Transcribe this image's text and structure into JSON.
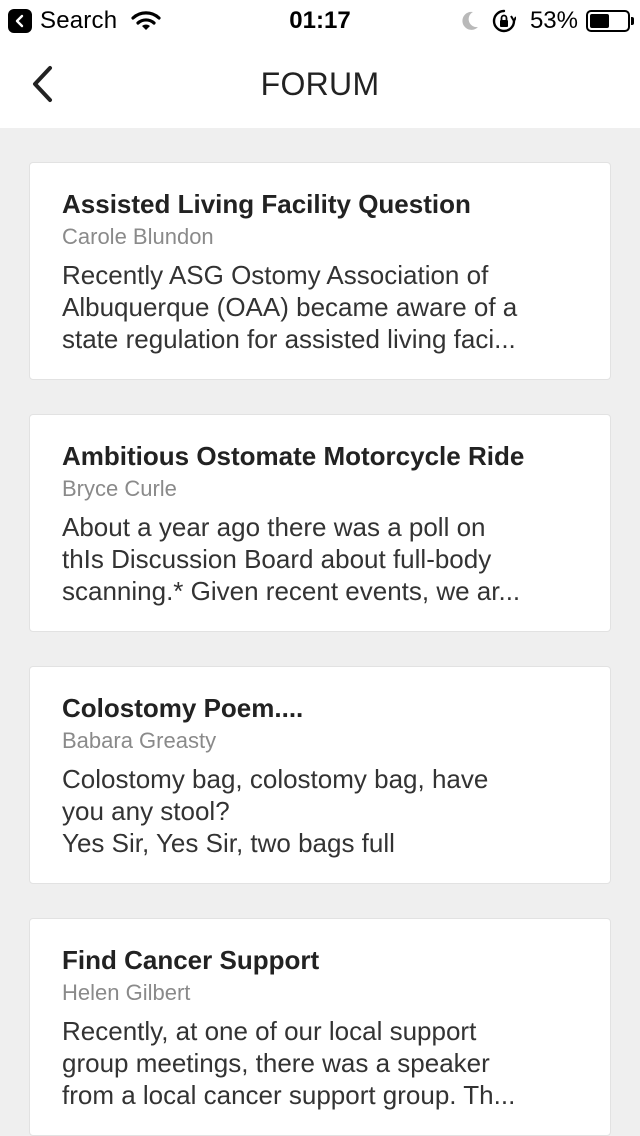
{
  "status_bar": {
    "back_app_label": "Search",
    "time": "01:17",
    "battery_percent": "53%",
    "battery_level": 0.53
  },
  "nav": {
    "title": "FORUM"
  },
  "posts": [
    {
      "title": "Assisted Living Facility Question",
      "author": "Carole Blundon",
      "excerpt": "Recently ASG Ostomy Association of\nAlbuquerque (OAA) became aware of a\nstate regulation for assisted living faci..."
    },
    {
      "title": "Ambitious Ostomate Motorcycle Ride",
      "author": "Bryce Curle",
      "excerpt": "About a year ago there was a poll on\nthIs Discussion Board about full-body\nscanning.* Given recent events, we ar..."
    },
    {
      "title": "Colostomy Poem....",
      "author": "Babara Greasty",
      "excerpt": "Colostomy bag, colostomy bag, have\nyou any stool?\n Yes Sir, Yes Sir, two bags full"
    },
    {
      "title": "Find Cancer Support",
      "author": "Helen Gilbert",
      "excerpt": "Recently, at one of our local support\ngroup meetings, there was a speaker\nfrom a local cancer support group. Th..."
    }
  ],
  "colors": {
    "background": "#efefef",
    "card": "#ffffff",
    "author_gray": "#8a8a8a"
  }
}
